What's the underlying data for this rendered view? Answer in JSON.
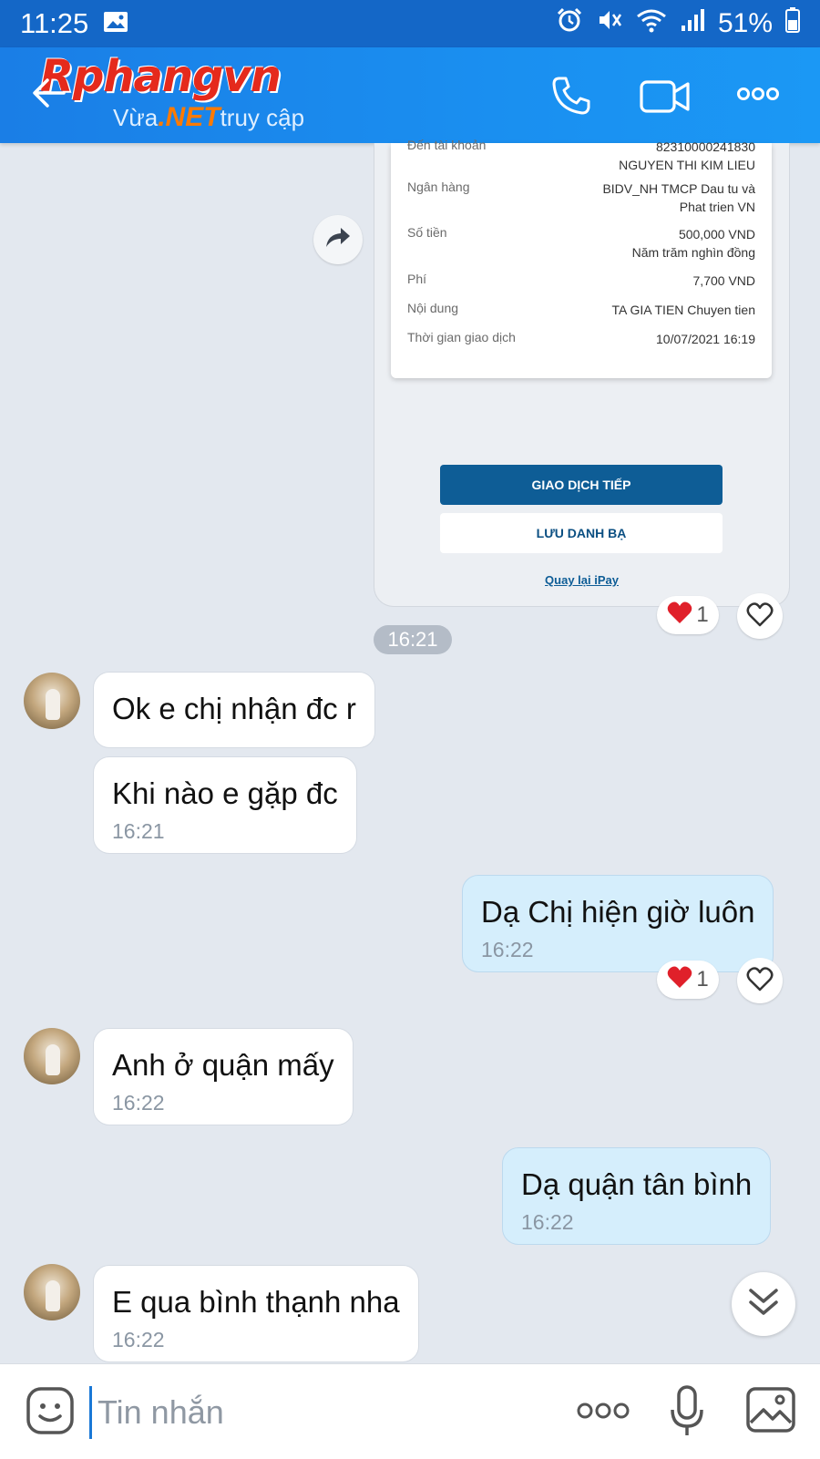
{
  "status": {
    "time": "11:25",
    "battery": "51%"
  },
  "header": {
    "logo_main": "Rphangvn",
    "logo_sub_pre": "Vừa",
    "logo_sub_net": ".NET",
    "logo_sub_post": "truy cập"
  },
  "receipt": {
    "partial_top_label": "Đến tài khoản",
    "account_number": "82310000241830",
    "account_name": "NGUYEN THI KIM LIEU",
    "bank_label": "Ngân hàng",
    "bank_value": [
      "BIDV_NH TMCP Dau tu và",
      "Phat trien VN"
    ],
    "amount_label": "Số tiền",
    "amount_value": [
      "500,000 VND",
      "Năm trăm nghìn đồng"
    ],
    "fee_label": "Phí",
    "fee_value": "7,700 VND",
    "content_label": "Nội dung",
    "content_value": "TA GIA TIEN Chuyen tien",
    "time_label": "Thời gian giao dịch",
    "time_value": "10/07/2021 16:19",
    "btn_next": "GIAO DỊCH TIẾP",
    "btn_save": "LƯU DANH BẠ",
    "link_back": "Quay lại iPay"
  },
  "reactions": {
    "count1": "1",
    "count2": "1"
  },
  "time_divider": "16:21",
  "messages": [
    {
      "text": "Ok e chị nhận đc r",
      "time": ""
    },
    {
      "text": "Khi nào e gặp đc",
      "time": "16:21"
    },
    {
      "text": "Dạ Chị hiện giờ luôn",
      "time": "16:22"
    },
    {
      "text": "Anh ở quận mấy",
      "time": "16:22"
    },
    {
      "text": "Dạ quận tân bình",
      "time": "16:22"
    },
    {
      "text": "E qua bình thạnh nha",
      "time": "16:22"
    }
  ],
  "composer": {
    "placeholder": "Tin nhắn"
  },
  "colors": {
    "header": "#1a88ec",
    "status_bar": "#1467c7",
    "outgoing_bubble": "#d5eefc",
    "heart": "#e0202a"
  },
  "icons": [
    "image-icon",
    "alarm-icon",
    "mute-icon",
    "wifi-icon",
    "signal-icon",
    "battery-icon",
    "back-arrow-icon",
    "phone-icon",
    "video-call-icon",
    "more-icon",
    "share-icon",
    "heart-icon",
    "heart-outline-icon",
    "chevron-double-down-icon",
    "sticker-icon",
    "mic-icon",
    "gallery-icon"
  ]
}
